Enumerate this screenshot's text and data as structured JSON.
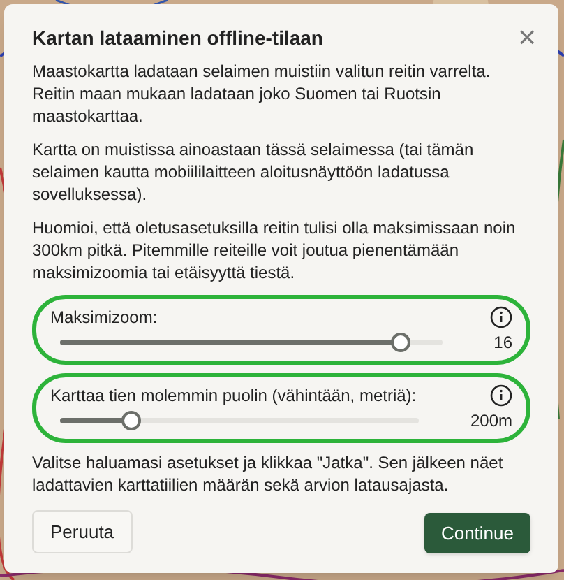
{
  "dialog": {
    "title": "Kartan lataaminen offline-tilaan",
    "close": "×",
    "paragraphs": [
      "Maastokartta ladataan selaimen muistiin valitun reitin varrelta. Reitin maan mukaan ladataan joko Suomen tai Ruotsin maastokarttaa.",
      "Kartta on muistissa ainoastaan tässä selaimessa (tai tämän selaimen kautta mobiililaitteen aloitusnäyttöön ladatussa sovelluksessa).",
      "Huomioi, että oletusasetuksilla reitin tulisi olla maksimissaan noin 300km pitkä. Pitemmille reiteille voit joutua pienentämään maksimizoomia tai etäisyyttä tiestä."
    ],
    "sliders": [
      {
        "label": "Maksimizoom:",
        "level": 0.89,
        "reading": "16"
      },
      {
        "label": "Karttaa tien molemmin puolin (vähintään, metriä):",
        "level": 0.2,
        "reading": "200m"
      }
    ],
    "footer_text": "Valitse haluamasi asetukset ja klikkaa \"Jatka\". Sen jälkeen näet ladattavien karttatiilien määrän sekä arvion latausajasta.",
    "buttons": [
      {
        "label": "Peruuta",
        "kind": "secondary"
      },
      {
        "label": "Continue",
        "kind": "primary"
      }
    ]
  }
}
